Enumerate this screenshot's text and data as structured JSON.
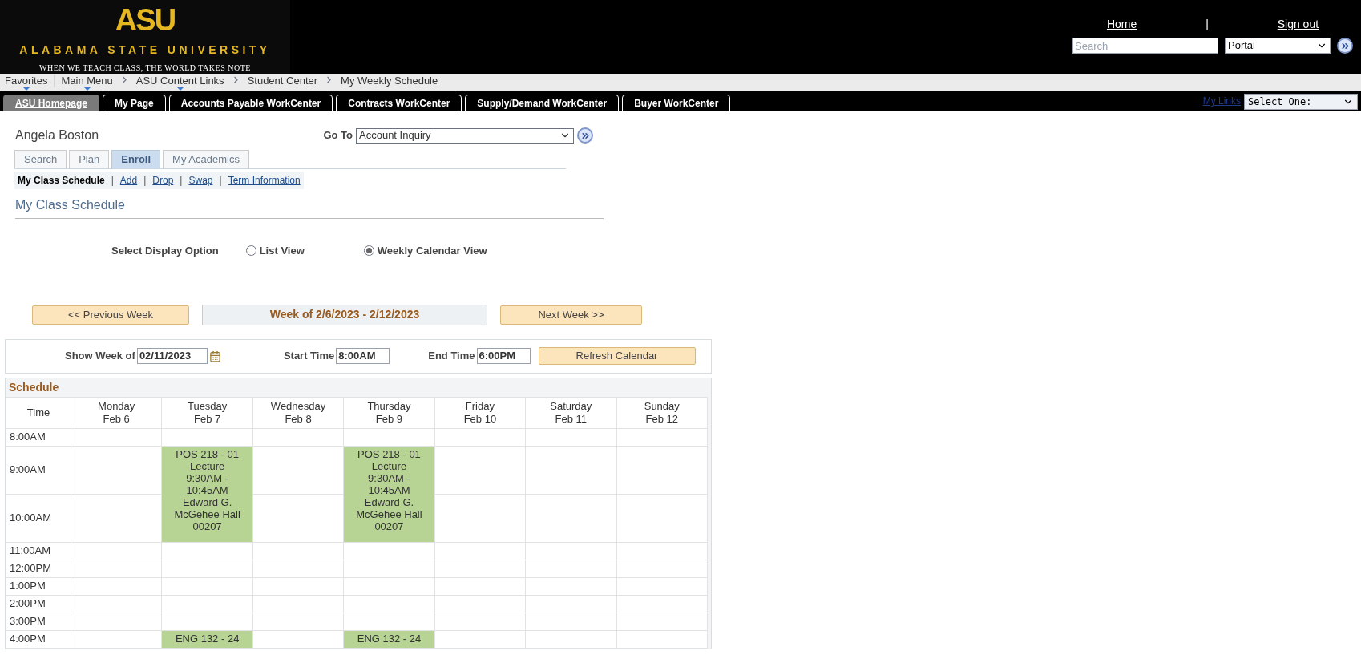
{
  "header": {
    "logo": {
      "mark": "ASU",
      "name": "ALABAMA STATE UNIVERSITY",
      "tagline": "WHEN WE TEACH CLASS, THE WORLD TAKES NOTE"
    },
    "links": [
      "Home",
      "Sign out"
    ],
    "separator": "|",
    "search": {
      "placeholder": "Search"
    },
    "scope": "Portal"
  },
  "breadcrumbs": [
    {
      "label": "Favorites",
      "menu": true
    },
    {
      "label": "Main Menu",
      "menu": true
    },
    {
      "label": "ASU Content Links",
      "menu": true
    },
    {
      "label": "Student Center",
      "menu": false
    },
    {
      "label": "My Weekly Schedule",
      "menu": false
    }
  ],
  "portal_tabs": [
    {
      "label": "ASU Homepage",
      "selected": true
    },
    {
      "label": "My Page",
      "selected": false
    },
    {
      "label": "Accounts Payable WorkCenter",
      "selected": false
    },
    {
      "label": "Contracts WorkCenter",
      "selected": false
    },
    {
      "label": "Supply/Demand WorkCenter",
      "selected": false
    },
    {
      "label": "Buyer WorkCenter",
      "selected": false
    }
  ],
  "my_links": {
    "label": "My Links",
    "select": "Select One:"
  },
  "student_name": "Angela Boston",
  "go_to": {
    "label": "Go To",
    "value": "Account Inquiry"
  },
  "tabs": [
    {
      "label": "Search",
      "selected": false
    },
    {
      "label": "Plan",
      "selected": false
    },
    {
      "label": "Enroll",
      "selected": true
    },
    {
      "label": "My Academics",
      "selected": false
    }
  ],
  "subnav": [
    {
      "label": "My Class Schedule",
      "selected": true
    },
    {
      "label": "Add",
      "selected": false
    },
    {
      "label": "Drop",
      "selected": false
    },
    {
      "label": "Swap",
      "selected": false
    },
    {
      "label": "Term Information",
      "selected": false
    }
  ],
  "subnav_separator": "|",
  "page_title": "My Class Schedule",
  "display_option": {
    "label": "Select Display Option",
    "options": [
      {
        "label": "List View",
        "selected": false
      },
      {
        "label": "Weekly Calendar View",
        "selected": true
      }
    ]
  },
  "week_nav": {
    "previous": "<< Previous Week",
    "title": "Week of 2/6/2023 - 2/12/2023",
    "next": "Next Week >>"
  },
  "filters": {
    "show_week": {
      "label": "Show Week of",
      "value": "02/11/2023"
    },
    "start_time": {
      "label": "Start Time",
      "value": "8:00AM"
    },
    "end_time": {
      "label": "End Time",
      "value": "6:00PM"
    },
    "refresh": "Refresh Calendar"
  },
  "schedule": {
    "title": "Schedule",
    "time_heading": "Time",
    "days": [
      {
        "day": "Monday",
        "date": "Feb 6"
      },
      {
        "day": "Tuesday",
        "date": "Feb 7"
      },
      {
        "day": "Wednesday",
        "date": "Feb 8"
      },
      {
        "day": "Thursday",
        "date": "Feb 9"
      },
      {
        "day": "Friday",
        "date": "Feb 10"
      },
      {
        "day": "Saturday",
        "date": "Feb 11"
      },
      {
        "day": "Sunday",
        "date": "Feb 12"
      }
    ],
    "rows": [
      {
        "time": "8:00AM",
        "cells": [
          {
            "kind": "empty"
          },
          {
            "kind": "empty"
          },
          {
            "kind": "empty"
          },
          {
            "kind": "empty"
          },
          {
            "kind": "empty"
          },
          {
            "kind": "empty"
          },
          {
            "kind": "empty"
          }
        ]
      },
      {
        "time": "9:00AM",
        "cells": [
          {
            "kind": "empty"
          },
          {
            "kind": "event",
            "lines": [
              "POS 218 - 01",
              "Lecture",
              "9:30AM -",
              "10:45AM",
              "Edward G.",
              "McGehee Hall",
              "00207"
            ]
          },
          {
            "kind": "empty"
          },
          {
            "kind": "event",
            "lines": [
              "POS 218 - 01",
              "Lecture",
              "9:30AM -",
              "10:45AM",
              "Edward G.",
              "McGehee Hall",
              "00207"
            ]
          },
          {
            "kind": "empty"
          },
          {
            "kind": "empty"
          },
          {
            "kind": "empty"
          }
        ]
      },
      {
        "time": "10:00AM",
        "cells": [
          {
            "kind": "empty"
          },
          {
            "kind": "covered"
          },
          {
            "kind": "empty"
          },
          {
            "kind": "covered"
          },
          {
            "kind": "empty"
          },
          {
            "kind": "empty"
          },
          {
            "kind": "empty"
          }
        ]
      },
      {
        "time": "11:00AM",
        "cells": [
          {
            "kind": "empty"
          },
          {
            "kind": "empty"
          },
          {
            "kind": "empty"
          },
          {
            "kind": "empty"
          },
          {
            "kind": "empty"
          },
          {
            "kind": "empty"
          },
          {
            "kind": "empty"
          }
        ]
      },
      {
        "time": "12:00PM",
        "cells": [
          {
            "kind": "empty"
          },
          {
            "kind": "empty"
          },
          {
            "kind": "empty"
          },
          {
            "kind": "empty"
          },
          {
            "kind": "empty"
          },
          {
            "kind": "empty"
          },
          {
            "kind": "empty"
          }
        ]
      },
      {
        "time": "1:00PM",
        "cells": [
          {
            "kind": "empty"
          },
          {
            "kind": "empty"
          },
          {
            "kind": "empty"
          },
          {
            "kind": "empty"
          },
          {
            "kind": "empty"
          },
          {
            "kind": "empty"
          },
          {
            "kind": "empty"
          }
        ]
      },
      {
        "time": "2:00PM",
        "cells": [
          {
            "kind": "empty"
          },
          {
            "kind": "empty"
          },
          {
            "kind": "empty"
          },
          {
            "kind": "empty"
          },
          {
            "kind": "empty"
          },
          {
            "kind": "empty"
          },
          {
            "kind": "empty"
          }
        ]
      },
      {
        "time": "3:00PM",
        "cells": [
          {
            "kind": "empty"
          },
          {
            "kind": "empty"
          },
          {
            "kind": "empty"
          },
          {
            "kind": "empty"
          },
          {
            "kind": "empty"
          },
          {
            "kind": "empty"
          },
          {
            "kind": "empty"
          }
        ]
      },
      {
        "time": "4:00PM",
        "cells": [
          {
            "kind": "empty"
          },
          {
            "kind": "event",
            "lines": [
              "ENG 132 - 24"
            ]
          },
          {
            "kind": "empty"
          },
          {
            "kind": "event",
            "lines": [
              "ENG 132 - 24"
            ]
          },
          {
            "kind": "empty"
          },
          {
            "kind": "empty"
          },
          {
            "kind": "empty"
          }
        ]
      }
    ]
  }
}
